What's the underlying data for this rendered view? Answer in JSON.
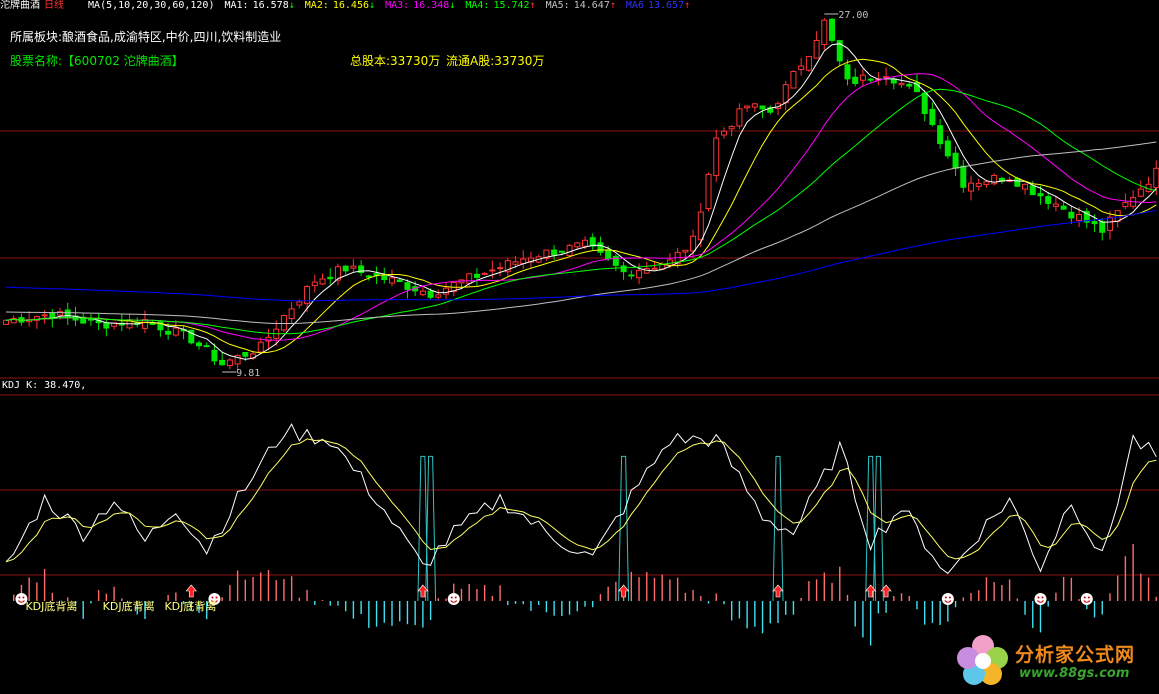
{
  "header": {
    "stock_title": "沱牌曲酒",
    "period": "日线",
    "ma_params": "MA(5,10,20,30,60,120)",
    "ma": [
      {
        "label": "MA1:",
        "value": "16.578",
        "arrow": "↓",
        "color": "#ffffff"
      },
      {
        "label": "MA2:",
        "value": "16.456",
        "arrow": "↓",
        "color": "#ffff00"
      },
      {
        "label": "MA3:",
        "value": "16.348",
        "arrow": "↓",
        "color": "#ff00ff"
      },
      {
        "label": "MA4:",
        "value": "15.742",
        "arrow": "↑",
        "color": "#00ff00"
      },
      {
        "label": "MA5:",
        "value": "14.647",
        "arrow": "↑",
        "color": "#c0c0c0"
      },
      {
        "label": "MA6",
        "value": "13.657",
        "arrow": "↑",
        "color": "#0000ff"
      }
    ]
  },
  "info": {
    "sector": "所属板块:酿酒食品,成渝特区,中价,四川,饮料制造业",
    "stock_name": "股票名称:【600702 沱牌曲酒】",
    "total_shares": "总股本:33730万",
    "float_shares": "流通A股:33730万"
  },
  "kdj_label": "KDJ K: 38.470,",
  "annotations": {
    "max_label": "27.00",
    "min_label": "9.81",
    "divergence": [
      {
        "text": "KDJ底背离",
        "n": 9
      },
      {
        "text": "KDJ底背离",
        "n": 19
      },
      {
        "text": "KDJ底背离",
        "n": 27
      },
      {
        "text": "KDJ底背离",
        "n": 198
      },
      {
        "text": "KDJ底背离",
        "n": 203
      }
    ],
    "up_arrows": [
      24,
      54,
      80,
      100,
      112,
      114
    ],
    "smileys": [
      2,
      27,
      58,
      122,
      134,
      140
    ]
  },
  "watermark": {
    "name": "分析家公式网",
    "url": "www.88gs.com"
  },
  "colors": {
    "up": "#ff3232",
    "down": "#00e600",
    "grid": "#8b1010",
    "k_line": "#ffffff",
    "d_line": "#ffff66",
    "bar_pos": "#ff6e6e",
    "bar_neg": "#40e0f0",
    "spike": "#2ec4c4"
  },
  "chart_data": [
    {
      "type": "candlestick",
      "title": "沱牌曲酒 日线",
      "x_count": 150,
      "ylim": [
        9.81,
        27.0
      ],
      "marked_high": 27.0,
      "marked_low": 9.81,
      "anchors": [
        [
          0,
          12.3
        ],
        [
          6,
          12.6
        ],
        [
          12,
          12.1
        ],
        [
          18,
          12.3
        ],
        [
          24,
          11.4
        ],
        [
          28,
          10.2
        ],
        [
          33,
          11.0
        ],
        [
          36,
          12.5
        ],
        [
          40,
          14.2
        ],
        [
          44,
          14.8
        ],
        [
          50,
          14.2
        ],
        [
          55,
          13.6
        ],
        [
          60,
          14.3
        ],
        [
          68,
          15.4
        ],
        [
          75,
          15.9
        ],
        [
          80,
          14.6
        ],
        [
          86,
          15.1
        ],
        [
          89,
          16.1
        ],
        [
          92,
          21.0
        ],
        [
          96,
          22.6
        ],
        [
          99,
          22.3
        ],
        [
          104,
          25.2
        ],
        [
          106,
          26.6
        ],
        [
          109,
          23.7
        ],
        [
          114,
          24.2
        ],
        [
          118,
          23.1
        ],
        [
          124,
          18.9
        ],
        [
          130,
          19.2
        ],
        [
          135,
          18.1
        ],
        [
          142,
          16.6
        ],
        [
          146,
          18.3
        ],
        [
          149,
          19.4
        ]
      ],
      "series": [
        {
          "name": "MA1",
          "color": "#ffffff",
          "window": 5
        },
        {
          "name": "MA2",
          "color": "#ffff00",
          "window": 10
        },
        {
          "name": "MA3",
          "color": "#ff00ff",
          "window": 20
        },
        {
          "name": "MA4",
          "color": "#00ff00",
          "window": 30
        },
        {
          "name": "MA5",
          "color": "#c0c0c0",
          "window": 60
        },
        {
          "name": "MA6",
          "color": "#0000ff",
          "window": 120
        }
      ]
    },
    {
      "type": "line",
      "title": "KDJ",
      "ylim": [
        -35,
        115
      ],
      "k_value": 38.47,
      "k_anchors": [
        [
          0,
          20
        ],
        [
          5,
          60
        ],
        [
          10,
          40
        ],
        [
          14,
          60
        ],
        [
          18,
          35
        ],
        [
          22,
          55
        ],
        [
          26,
          30
        ],
        [
          30,
          60
        ],
        [
          36,
          100
        ],
        [
          42,
          95
        ],
        [
          48,
          60
        ],
        [
          54,
          20
        ],
        [
          58,
          40
        ],
        [
          64,
          60
        ],
        [
          70,
          40
        ],
        [
          76,
          25
        ],
        [
          80,
          55
        ],
        [
          86,
          95
        ],
        [
          92,
          95
        ],
        [
          98,
          50
        ],
        [
          102,
          40
        ],
        [
          108,
          90
        ],
        [
          112,
          35
        ],
        [
          116,
          55
        ],
        [
          122,
          15
        ],
        [
          126,
          40
        ],
        [
          130,
          60
        ],
        [
          134,
          20
        ],
        [
          138,
          60
        ],
        [
          142,
          25
        ],
        [
          146,
          95
        ],
        [
          149,
          85
        ]
      ],
      "d_smoothing": 3,
      "spikes": [
        54,
        55,
        80,
        100,
        112,
        113
      ],
      "spike_height": 85
    }
  ]
}
